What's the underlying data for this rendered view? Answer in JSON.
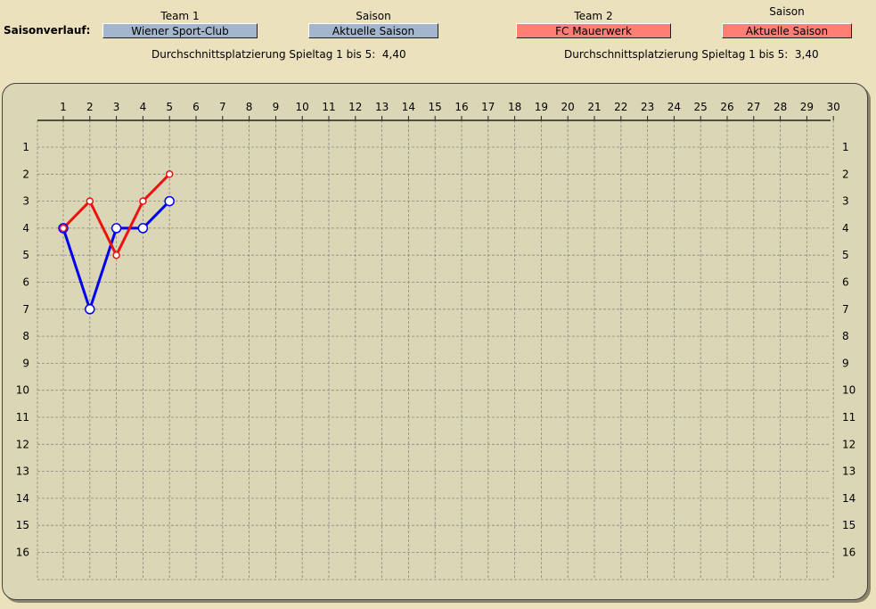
{
  "header": {
    "title": "Saisonverlauf:",
    "team1": {
      "label": "Team 1",
      "value": "Wiener Sport-Club",
      "color": "#a3b6cc"
    },
    "season1": {
      "label": "Saison",
      "value": "Aktuelle Saison",
      "color": "#a3b6cc"
    },
    "team2": {
      "label": "Team 2",
      "value": "FC Mauerwerk",
      "color": "#ff7f75"
    },
    "season2": {
      "label": "Saison",
      "value": "Aktuelle Saison",
      "color": "#ff7f75"
    },
    "avg1": "Durchschnittsplatzierung Spieltag 1 bis 5:  4,40",
    "avg2": "Durchschnittsplatzierung Spieltag 1 bis 5:  3,40"
  },
  "chart_data": {
    "type": "line",
    "x_ticks": [
      1,
      2,
      3,
      4,
      5,
      6,
      7,
      8,
      9,
      10,
      11,
      12,
      13,
      14,
      15,
      16,
      17,
      18,
      19,
      20,
      21,
      22,
      23,
      24,
      25,
      26,
      27,
      28,
      29,
      30
    ],
    "y_ticks": [
      1,
      2,
      3,
      4,
      5,
      6,
      7,
      8,
      9,
      10,
      11,
      12,
      13,
      14,
      15,
      16
    ],
    "xlim": [
      1,
      30
    ],
    "ylim": [
      1,
      16
    ],
    "y_inverted": true,
    "grid": true,
    "series": [
      {
        "x": [
          1,
          2,
          3,
          4,
          5
        ],
        "y": [
          4,
          7,
          4,
          4,
          3
        ],
        "color": "#0000ee"
      },
      {
        "x": [
          1,
          2,
          3,
          4,
          5
        ],
        "y": [
          4,
          3,
          5,
          3,
          2
        ],
        "color": "#ee1111"
      }
    ]
  }
}
